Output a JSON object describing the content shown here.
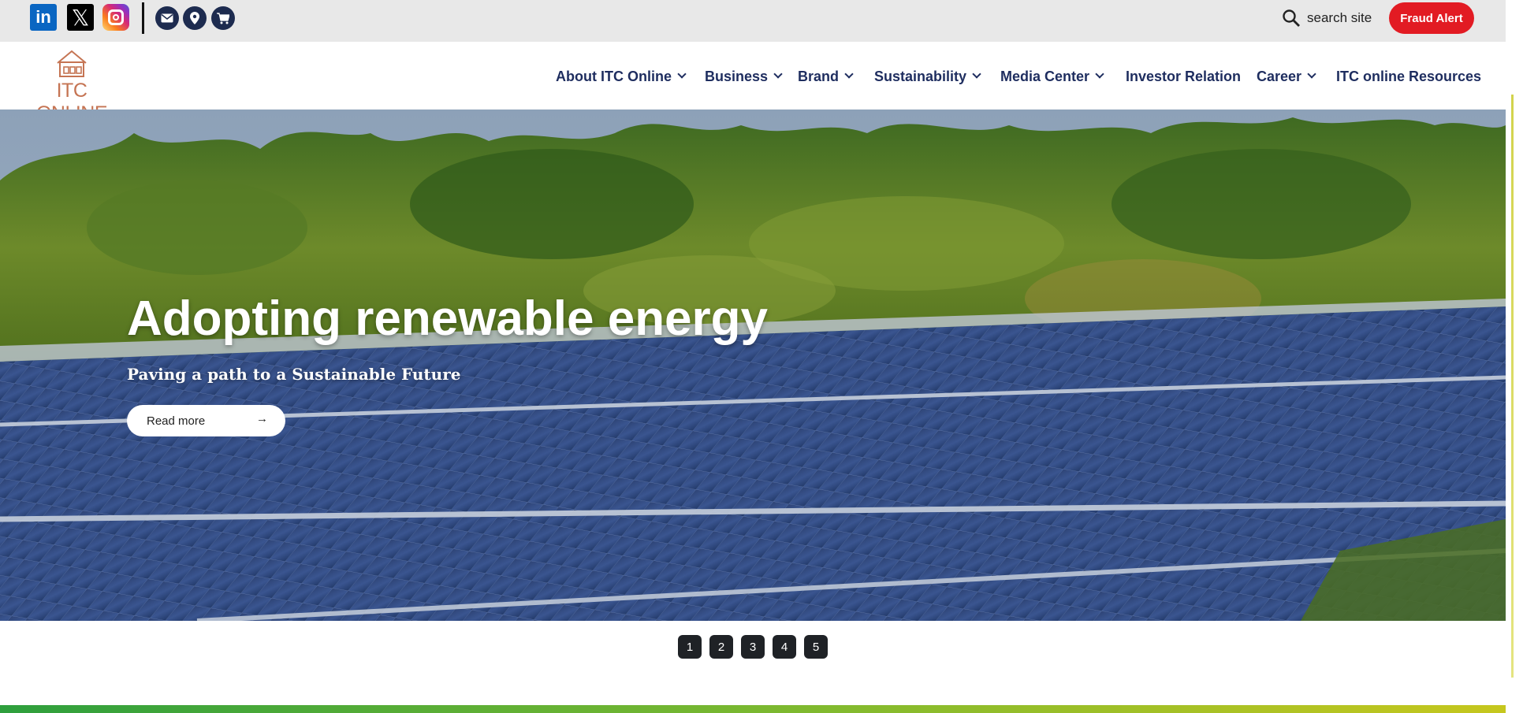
{
  "topbar": {
    "social": [
      {
        "name": "linkedin",
        "glyph": "in"
      },
      {
        "name": "x",
        "glyph": "𝕏"
      },
      {
        "name": "instagram",
        "glyph": ""
      }
    ],
    "contact_icons": [
      "mail-icon",
      "location-pin-icon",
      "cart-icon"
    ],
    "search_label": "search site",
    "fraud_alert_label": "Fraud Alert"
  },
  "logo": {
    "text": "ITC ONLINE"
  },
  "nav": {
    "items": [
      {
        "label": "About ITC Online",
        "has_dropdown": true
      },
      {
        "label": "Business",
        "has_dropdown": true
      },
      {
        "label": "Brand",
        "has_dropdown": true
      },
      {
        "label": "Sustainability",
        "has_dropdown": true
      },
      {
        "label": "Media Center",
        "has_dropdown": true
      },
      {
        "label": "Investor Relation",
        "has_dropdown": false
      },
      {
        "label": "Career",
        "has_dropdown": true
      },
      {
        "label": "ITC online Resources",
        "has_dropdown": false
      }
    ]
  },
  "hero": {
    "title": "Adopting renewable energy",
    "subtitle": "Paving a path to a Sustainable Future",
    "cta_label": "Read more",
    "cta_arrow": "→"
  },
  "pager": {
    "pages": [
      "1",
      "2",
      "3",
      "4",
      "5"
    ]
  },
  "colors": {
    "nav_text": "#1e2d5f",
    "fraud_button": "#e21b23",
    "logo": "#c57453",
    "pager_bg": "#1f2226"
  }
}
